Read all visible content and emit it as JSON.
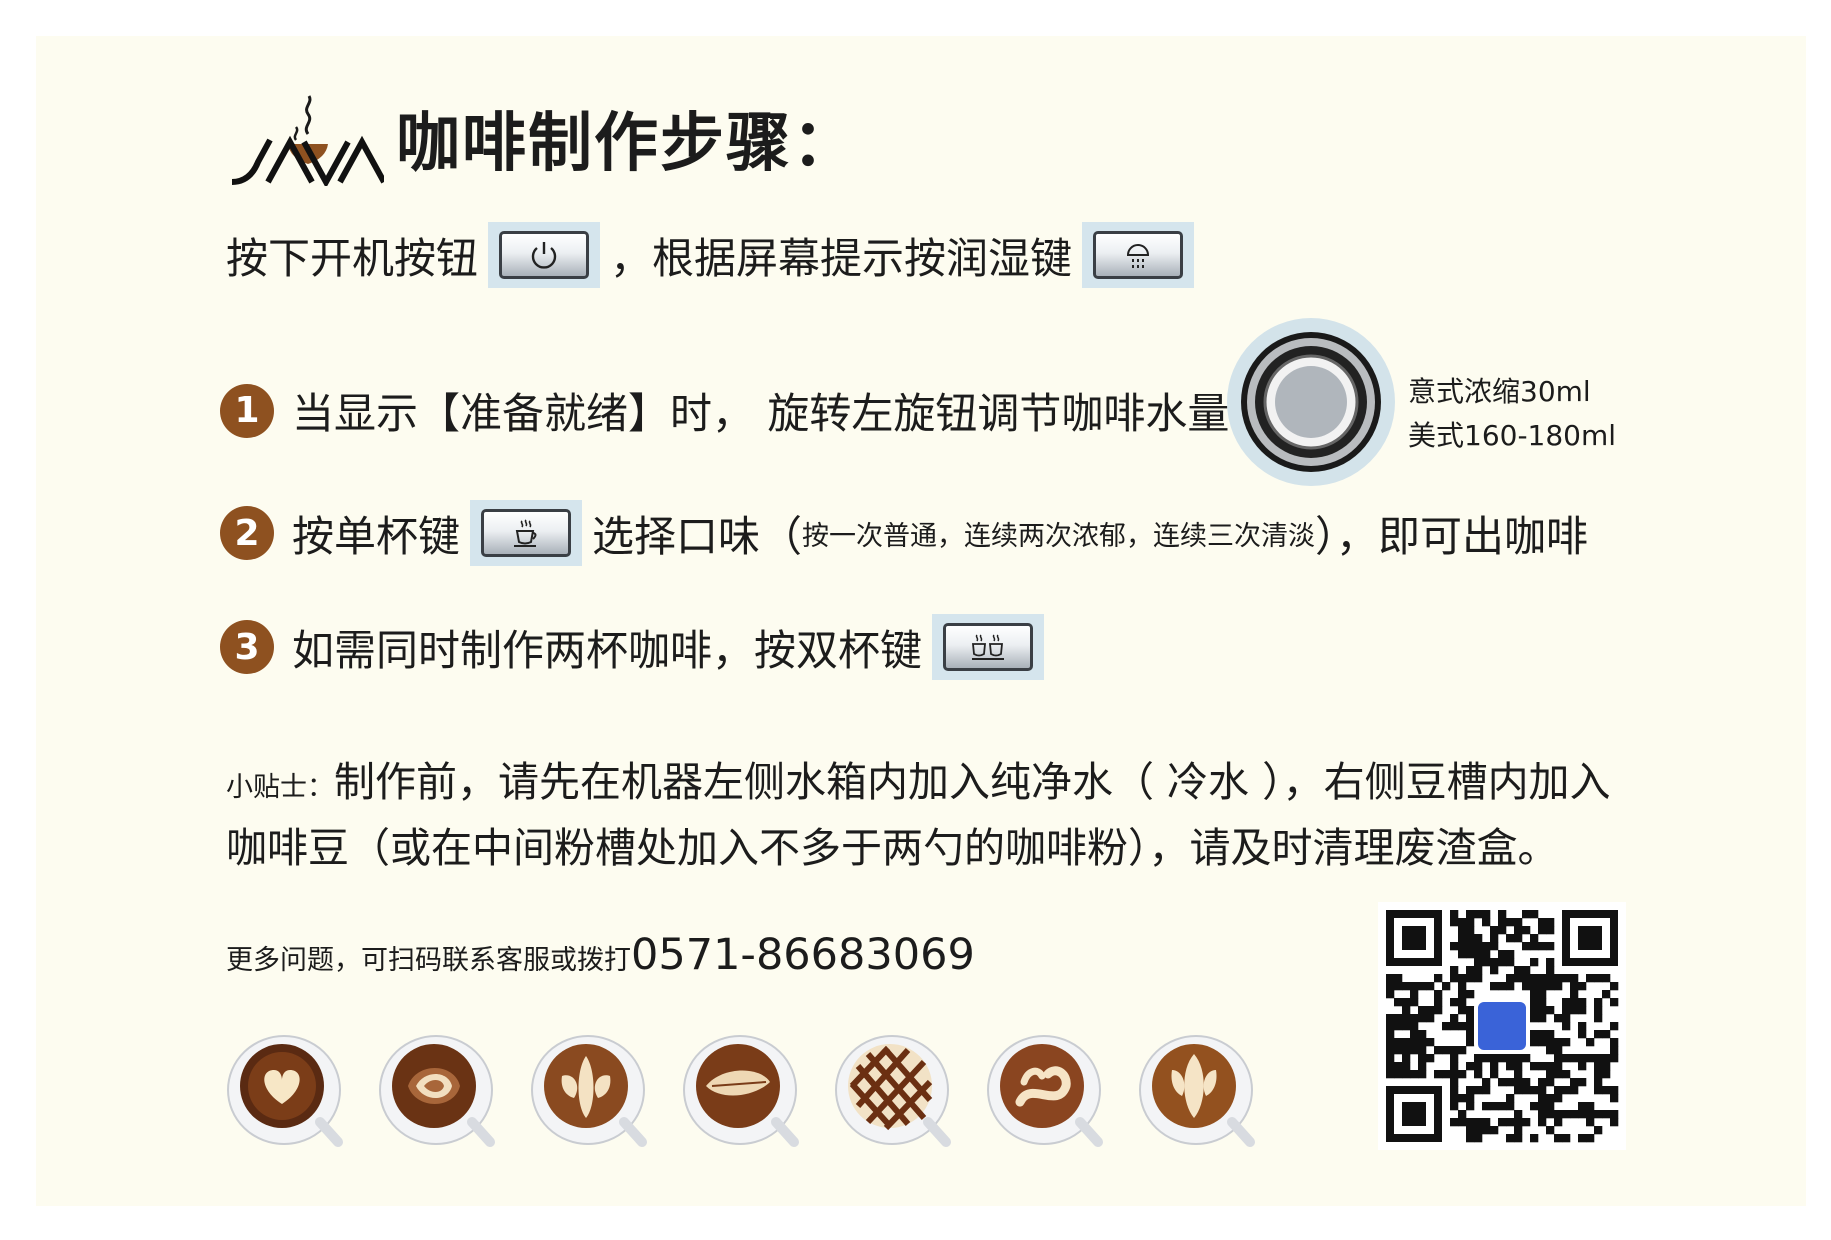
{
  "header": {
    "title": "咖啡制作步骤："
  },
  "intro": {
    "part1": "按下开机按钮",
    "part2": "，根据屏幕提示按润湿键"
  },
  "steps": [
    {
      "number": "1",
      "text": "当显示【准备就绪】时， 旋转左旋钮调节咖啡水量"
    },
    {
      "number": "2",
      "text_before": "按单杯键",
      "text_after": "选择口味（",
      "note": "按一次普通，连续两次浓郁，连续三次清淡",
      "text_end": "），即可出咖啡"
    },
    {
      "number": "3",
      "text": "如需同时制作两杯咖啡，按双杯键"
    }
  ],
  "knob_note": {
    "line1": "意式浓缩30ml",
    "line2": "美式160-180ml"
  },
  "tip": {
    "label": "小贴士：",
    "text": "制作前，请先在机器左侧水箱内加入纯净水（ 冷水 ），右侧豆槽内加入咖啡豆（或在中间粉槽处加入不多于两勺的咖啡粉），请及时清理废渣盒。"
  },
  "contact": {
    "text": "更多问题，可扫码联系客服或拨打",
    "phone": "0571-86683069"
  },
  "icons": {
    "logo": "java-logo",
    "power": "power-icon",
    "rinse": "rinse-icon",
    "single_cup": "single-cup-icon",
    "double_cup": "double-cup-icon",
    "knob": "rotary-knob",
    "qr": "qr-code"
  },
  "colors": {
    "background": "#fdfcf0",
    "step_badge": "#8e5120",
    "key_bg": "#d5e5ed"
  }
}
